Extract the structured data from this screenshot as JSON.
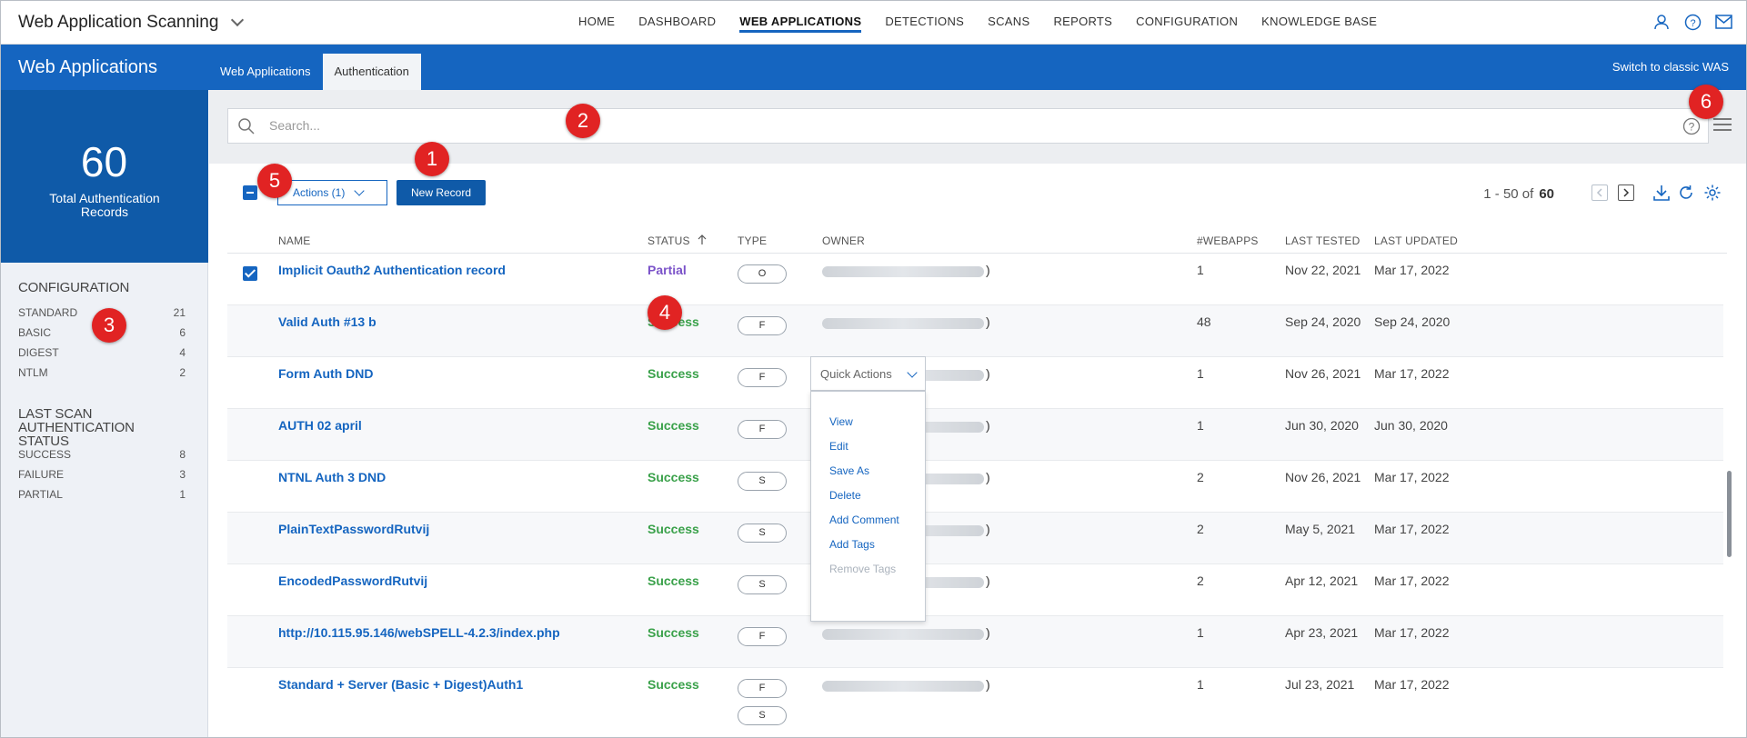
{
  "app": {
    "title": "Web Application Scanning"
  },
  "topnav": {
    "items": [
      {
        "label": "HOME",
        "active": false
      },
      {
        "label": "DASHBOARD",
        "active": false
      },
      {
        "label": "WEB APPLICATIONS",
        "active": true
      },
      {
        "label": "DETECTIONS",
        "active": false
      },
      {
        "label": "SCANS",
        "active": false
      },
      {
        "label": "REPORTS",
        "active": false
      },
      {
        "label": "CONFIGURATION",
        "active": false
      },
      {
        "label": "KNOWLEDGE BASE",
        "active": false
      }
    ],
    "icons": [
      "user-icon",
      "help-icon",
      "mail-icon"
    ]
  },
  "band": {
    "title": "Web Applications",
    "tabs": [
      {
        "label": "Web Applications",
        "active": false
      },
      {
        "label": "Authentication",
        "active": true
      }
    ],
    "switch_label": "Switch to classic WAS"
  },
  "summary": {
    "count": "60",
    "label": "Total Authentication Records"
  },
  "filters": {
    "configuration": {
      "title": "CONFIGURATION",
      "items": [
        {
          "label": "STANDARD",
          "count": "21"
        },
        {
          "label": "BASIC",
          "count": "6"
        },
        {
          "label": "DIGEST",
          "count": "4"
        },
        {
          "label": "NTLM",
          "count": "2"
        }
      ]
    },
    "status": {
      "title": "LAST SCAN AUTHENTICATION STATUS",
      "items": [
        {
          "label": "SUCCESS",
          "count": "8"
        },
        {
          "label": "FAILURE",
          "count": "3"
        },
        {
          "label": "PARTIAL",
          "count": "1"
        }
      ]
    }
  },
  "search": {
    "placeholder": "Search..."
  },
  "toolbar": {
    "actions_label": "Actions (1)",
    "new_record_label": "New Record",
    "pager_range": "1 - 50 of",
    "pager_total": "60"
  },
  "table": {
    "columns": {
      "name": "NAME",
      "status": "STATUS",
      "type": "TYPE",
      "owner": "OWNER",
      "webapps": "#WEBAPPS",
      "last_tested": "LAST TESTED",
      "last_updated": "LAST UPDATED"
    },
    "rows": [
      {
        "name": "Implicit Oauth2 Authentication record",
        "status": "Partial",
        "types": [
          "O"
        ],
        "owner_suffix": ")",
        "webapps": "1",
        "last_tested": "Nov 22, 2021",
        "last_updated": "Mar 17, 2022",
        "checked": true
      },
      {
        "name": "Valid Auth #13 b",
        "status": "Success",
        "types": [
          "F"
        ],
        "owner_suffix": ")",
        "webapps": "48",
        "last_tested": "Sep 24, 2020",
        "last_updated": "Sep 24, 2020",
        "checked": false
      },
      {
        "name": "Form Auth DND",
        "status": "Success",
        "types": [
          "F"
        ],
        "owner_suffix": ")",
        "webapps": "1",
        "last_tested": "Nov 26, 2021",
        "last_updated": "Mar 17, 2022",
        "checked": false
      },
      {
        "name": "AUTH 02 april",
        "status": "Success",
        "types": [
          "F"
        ],
        "owner_suffix": ")",
        "webapps": "1",
        "last_tested": "Jun 30, 2020",
        "last_updated": "Jun 30, 2020",
        "checked": false
      },
      {
        "name": "NTNL Auth 3 DND",
        "status": "Success",
        "types": [
          "S"
        ],
        "owner_suffix": ")",
        "webapps": "2",
        "last_tested": "Nov 26, 2021",
        "last_updated": "Mar 17, 2022",
        "checked": false
      },
      {
        "name": "PlainTextPasswordRutvij",
        "status": "Success",
        "types": [
          "S"
        ],
        "owner_suffix": ")",
        "webapps": "2",
        "last_tested": "May 5, 2021",
        "last_updated": "Mar 17, 2022",
        "checked": false
      },
      {
        "name": "EncodedPasswordRutvij",
        "status": "Success",
        "types": [
          "S"
        ],
        "owner_suffix": ")",
        "webapps": "2",
        "last_tested": "Apr 12, 2021",
        "last_updated": "Mar 17, 2022",
        "checked": false
      },
      {
        "name": "http://10.115.95.146/webSPELL-4.2.3/index.php",
        "status": "Success",
        "types": [
          "F"
        ],
        "owner_suffix": ")",
        "webapps": "1",
        "last_tested": "Apr 23, 2021",
        "last_updated": "Mar 17, 2022",
        "checked": false
      },
      {
        "name": "Standard + Server (Basic + Digest)Auth1",
        "status": "Success",
        "types": [
          "F",
          "S"
        ],
        "owner_suffix": ")",
        "webapps": "1",
        "last_tested": "Jul 23, 2021",
        "last_updated": "Mar 17, 2022",
        "checked": false
      }
    ]
  },
  "quick_actions": {
    "label": "Quick Actions",
    "items": [
      {
        "label": "View",
        "disabled": false
      },
      {
        "label": "Edit",
        "disabled": false
      },
      {
        "label": "Save As",
        "disabled": false
      },
      {
        "label": "Delete",
        "disabled": false
      },
      {
        "label": "Add Comment",
        "disabled": false
      },
      {
        "label": "Add Tags",
        "disabled": false
      },
      {
        "label": "Remove Tags",
        "disabled": true
      }
    ]
  },
  "callouts": [
    "1",
    "2",
    "3",
    "4",
    "5",
    "6"
  ],
  "colors": {
    "brand_blue": "#1565c0",
    "success": "#3aa14a",
    "partial": "#7b53c9",
    "callout": "#e12323"
  }
}
